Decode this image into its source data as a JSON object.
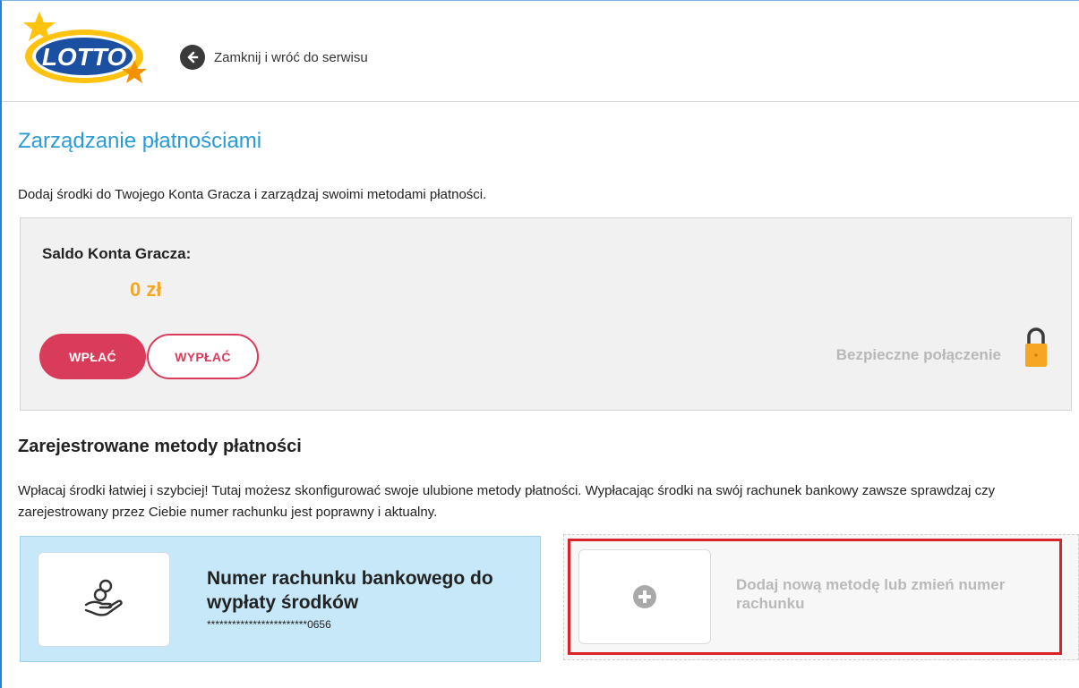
{
  "header": {
    "logo_text": "LOTTO",
    "back_label": "Zamknij i wróć do serwisu"
  },
  "page": {
    "title": "Zarządzanie płatnościami",
    "intro": "Dodaj środki do Twojego Konta Gracza i zarządzaj swoimi metodami płatności."
  },
  "balance": {
    "label": "Saldo Konta Gracza:",
    "value": "0 zł",
    "deposit_label": "WPŁAĆ",
    "withdraw_label": "WYPŁAĆ",
    "secure_label": "Bezpieczne połączenie"
  },
  "methods": {
    "title": "Zarejestrowane metody płatności",
    "description": "Wpłacaj środki łatwiej i szybciej! Tutaj możesz skonfigurować swoje ulubione metody płatności. Wypłacając środki na swój rachunek bankowy zawsze sprawdzaj czy zarejestrowany przez Ciebie numer rachunku jest poprawny i aktualny.",
    "bank_card": {
      "title": "Numer rachunku bankowego do wypłaty środków",
      "number": "************************0656",
      "icon": "hand-coins-icon"
    },
    "add_card": {
      "label": "Dodaj nową metodę lub zmień numer rachunku",
      "icon": "plus-circle-icon"
    }
  },
  "colors": {
    "accent": "#2a9bd4",
    "primary_button": "#d93b5b",
    "balance": "#f5a623",
    "bank_card_bg": "#c7e8f9",
    "highlight": "#d8232a"
  }
}
